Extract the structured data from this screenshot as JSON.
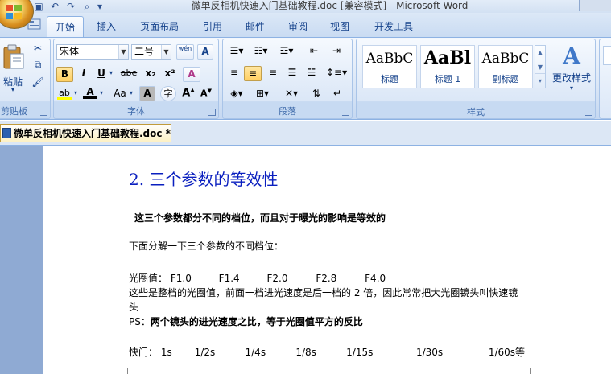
{
  "window": {
    "title": "微单反相机快速入门基础教程.doc [兼容模式] - Microsoft Word"
  },
  "ribbon": {
    "tabs": [
      "开始",
      "插入",
      "页面布局",
      "引用",
      "邮件",
      "审阅",
      "视图",
      "开发工具"
    ],
    "active_tab": "开始",
    "clipboard": {
      "paste_label": "粘贴",
      "group_label": "剪贴板"
    },
    "font": {
      "font_name": "宋体",
      "font_size": "二号",
      "group_label": "字体",
      "bold": "B",
      "italic": "I",
      "underline": "U",
      "strike": "abe",
      "subscript": "x₂",
      "superscript": "x²",
      "change_case": "Aa",
      "grow": "A",
      "shrink": "A",
      "char_border": "A",
      "phonetic": "wén",
      "enclose": "字",
      "clear_format": "A"
    },
    "paragraph": {
      "group_label": "段落"
    },
    "styles": {
      "group_label": "样式",
      "items": [
        {
          "sample": "AaBbC",
          "name": "标题"
        },
        {
          "sample": "AaBl",
          "name": "标题 1"
        },
        {
          "sample": "AaBbC",
          "name": "副标题"
        }
      ],
      "change_styles_label": "更改样式"
    }
  },
  "document_tab": {
    "label": "微单反相机快速入门基础教程.doc *"
  },
  "document": {
    "heading": "2. 三个参数的等效性",
    "bold_statement": "这三个参数都分不同的档位，而且对于曝光的影响是等效的",
    "intro": "下面分解一下三个参数的不同档位：",
    "aperture_label": "光圈值：",
    "aperture_values": [
      "F1.0",
      "F1.4",
      "F2.0",
      "F2.8",
      "F4.0"
    ],
    "aperture_desc_1": "这些是整档的光圈值，前面一档进光速度是后一档的 2 倍，因此常常把大光圈镜头叫快速镜",
    "aperture_desc_2": "头",
    "ps_label": "PS：",
    "ps_text": "两个镜头的进光速度之比，等于光圈值平方的反比",
    "shutter_label": "快门：",
    "shutter_values": [
      "1s",
      "1/2s",
      "1/4s",
      "1/8s",
      "1/15s",
      "1/30s",
      "1/60s"
    ],
    "shutter_suffix": "等"
  },
  "colors": {
    "heading": "#0a1fbf",
    "ribbon_text": "#15428b",
    "workspace": "#8faad3"
  }
}
